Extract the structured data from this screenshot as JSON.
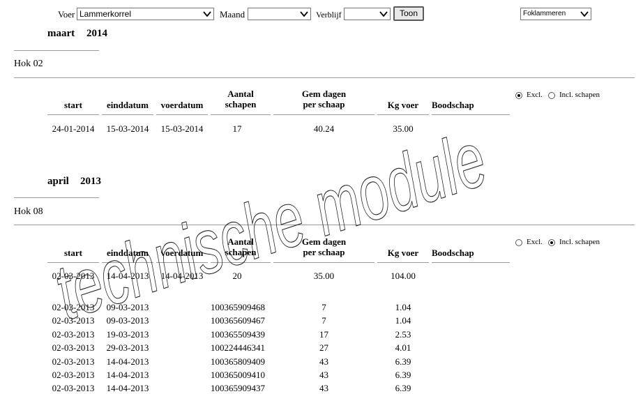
{
  "filters": {
    "voer_label": "Voer",
    "voer_value": "Lammerkorrel",
    "maand_label": "Maand",
    "maand_value": "",
    "verblijf_label": "Verblijf",
    "verblijf_value": "",
    "toon_button": "Toon",
    "right_select_value": "Foklammeren"
  },
  "columns": {
    "start": "start",
    "einddatum": "einddatum",
    "voerdatum": "voerdatum",
    "aantal_1": "Aantal",
    "aantal_2": "schapen",
    "gem_1": "Gem dagen",
    "gem_2": "per schaap",
    "kg": "Kg voer",
    "boodschap": "Boodschap"
  },
  "radio": {
    "excl": "Excl.",
    "incl": "Incl. schapen"
  },
  "section1": {
    "month": "maart",
    "year": "2014",
    "hok": "Hok 02",
    "mode": "excl",
    "row": {
      "start": "24-01-2014",
      "eind": "15-03-2014",
      "voer": "15-03-2014",
      "aantal": "17",
      "gem": "40.24",
      "kg": "35.00"
    }
  },
  "section2": {
    "month": "april",
    "year": "2013",
    "hok": "Hok 08",
    "mode": "incl",
    "row": {
      "start": "02-03-2013",
      "eind": "14-04-2013",
      "voer": "14-04-2013",
      "aantal": "20",
      "gem": "35.00",
      "kg": "104.00"
    },
    "detail": [
      {
        "start": "02-03-2013",
        "eind": "09-03-2013",
        "id": "100365909468",
        "dagen": "7",
        "kg": "1.04"
      },
      {
        "start": "02-03-2013",
        "eind": "09-03-2013",
        "id": "100365609467",
        "dagen": "7",
        "kg": "1.04"
      },
      {
        "start": "02-03-2013",
        "eind": "19-03-2013",
        "id": "100365509439",
        "dagen": "17",
        "kg": "2.53"
      },
      {
        "start": "02-03-2013",
        "eind": "29-03-2013",
        "id": "100224446341",
        "dagen": "27",
        "kg": "4.01"
      },
      {
        "start": "02-03-2013",
        "eind": "14-04-2013",
        "id": "100365809409",
        "dagen": "43",
        "kg": "6.39"
      },
      {
        "start": "02-03-2013",
        "eind": "14-04-2013",
        "id": "100365009410",
        "dagen": "43",
        "kg": "6.39"
      },
      {
        "start": "02-03-2013",
        "eind": "14-04-2013",
        "id": "100365909437",
        "dagen": "43",
        "kg": "6.39"
      }
    ]
  },
  "watermark": "technische module"
}
